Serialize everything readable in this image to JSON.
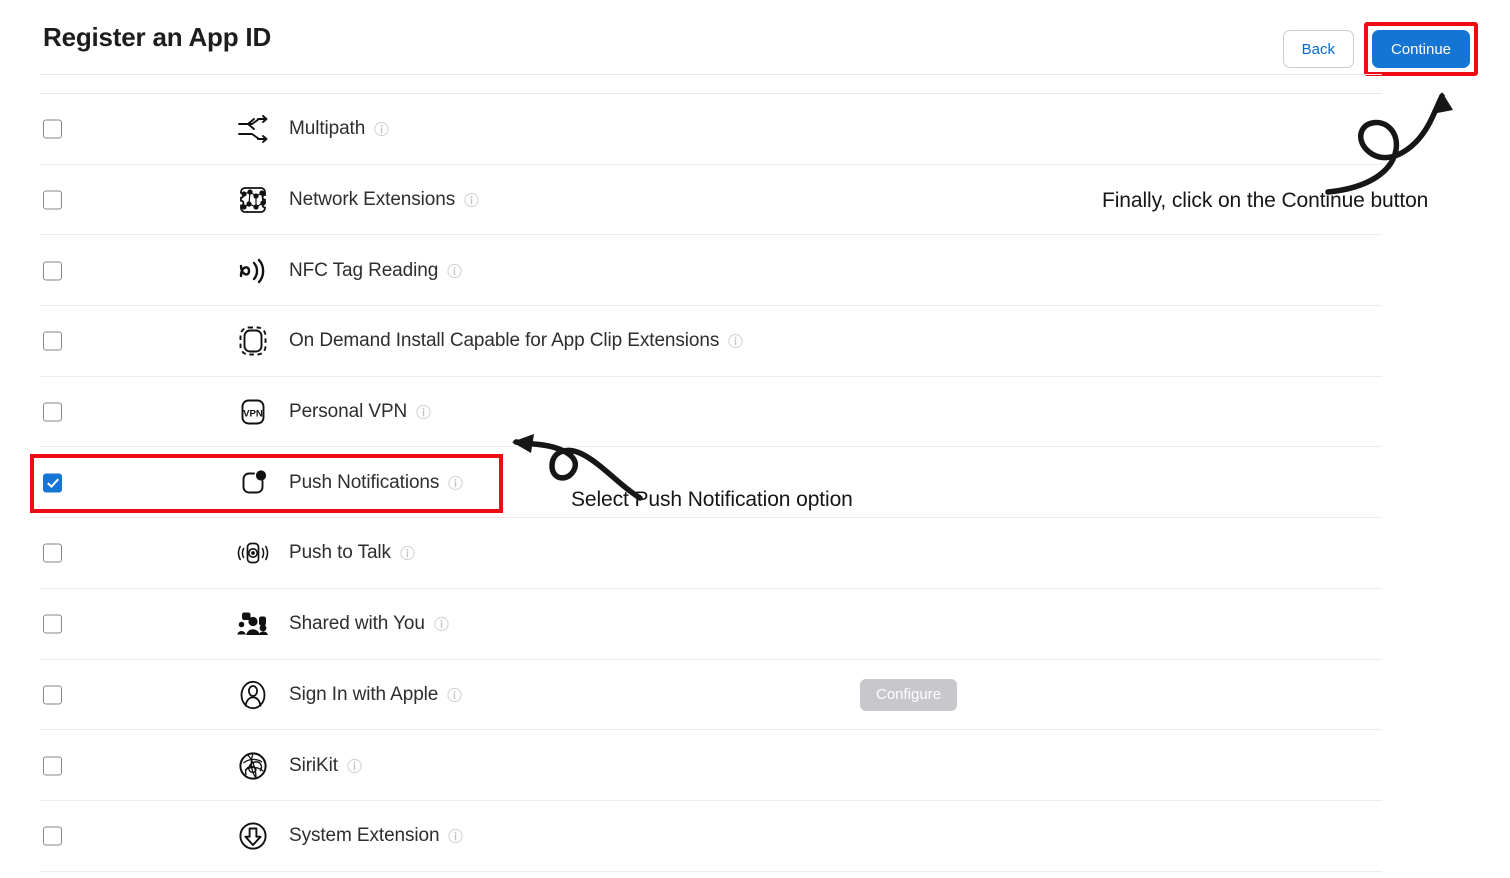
{
  "header": {
    "title": "Register an App ID",
    "back_label": "Back",
    "continue_label": "Continue"
  },
  "capabilities": [
    {
      "label": "Multipath",
      "icon": "multipath-icon",
      "checked": false,
      "info": "info-icon",
      "action": null
    },
    {
      "label": "Network Extensions",
      "icon": "network-extensions-icon",
      "checked": false,
      "info": "info-icon",
      "action": null
    },
    {
      "label": "NFC Tag Reading",
      "icon": "nfc-tag-reading-icon",
      "checked": false,
      "info": "info-icon",
      "action": null
    },
    {
      "label": "On Demand Install Capable for App Clip Extensions",
      "icon": "app-clip-icon",
      "checked": false,
      "info": "info-icon",
      "action": null
    },
    {
      "label": "Personal VPN",
      "icon": "personal-vpn-icon",
      "checked": false,
      "info": "info-icon",
      "action": null
    },
    {
      "label": "Push Notifications",
      "icon": "push-notifications-icon",
      "checked": true,
      "info": "info-icon",
      "action": null
    },
    {
      "label": "Push to Talk",
      "icon": "push-to-talk-icon",
      "checked": false,
      "info": "info-icon",
      "action": null
    },
    {
      "label": "Shared with You",
      "icon": "shared-with-you-icon",
      "checked": false,
      "info": "info-icon",
      "action": null
    },
    {
      "label": "Sign In with Apple",
      "icon": "sign-in-with-apple-icon",
      "checked": false,
      "info": "info-icon",
      "action": "Configure"
    },
    {
      "label": "SiriKit",
      "icon": "sirikit-icon",
      "checked": false,
      "info": "info-icon",
      "action": null
    },
    {
      "label": "System Extension",
      "icon": "system-extension-icon",
      "checked": false,
      "info": "info-icon",
      "action": null
    }
  ],
  "annotations": [
    {
      "text": "Finally, click on the Continue button",
      "target": "continue-button"
    },
    {
      "text": "Select Push Notification option",
      "target": "push-notifications-row"
    }
  ],
  "colors": {
    "primary_button": "#1575d4",
    "annotation_red": "#ef0b14",
    "checkbox_checked": "#1575d4",
    "link_blue": "#0a6bd4",
    "disabled_button": "#c7c7cc",
    "row_separator": "#ececee",
    "label_text": "#2e2e30"
  }
}
